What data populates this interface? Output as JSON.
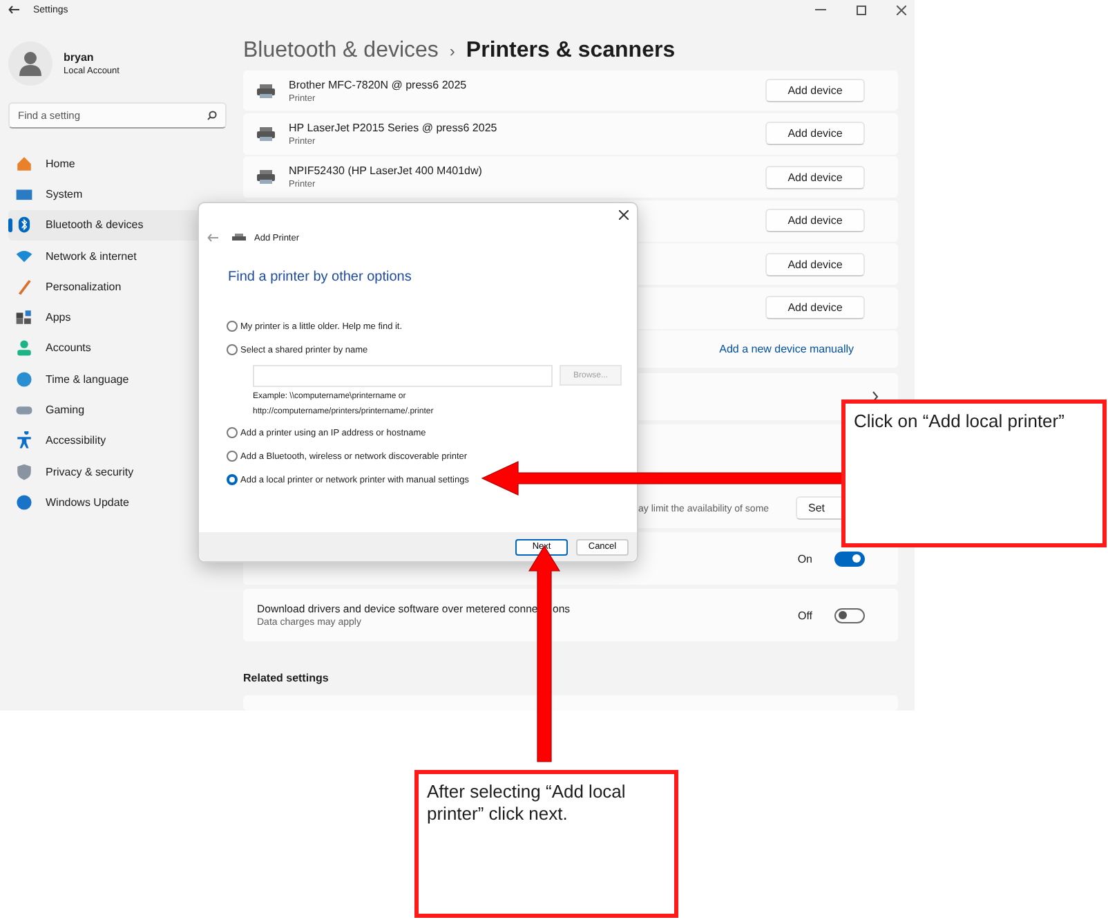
{
  "window": {
    "title": "Settings"
  },
  "account": {
    "name": "bryan",
    "type": "Local Account"
  },
  "search": {
    "placeholder": "Find a setting"
  },
  "nav": [
    {
      "label": "Home",
      "selected": false
    },
    {
      "label": "System",
      "selected": false
    },
    {
      "label": "Bluetooth & devices",
      "selected": true
    },
    {
      "label": "Network & internet",
      "selected": false
    },
    {
      "label": "Personalization",
      "selected": false
    },
    {
      "label": "Apps",
      "selected": false
    },
    {
      "label": "Accounts",
      "selected": false
    },
    {
      "label": "Time & language",
      "selected": false
    },
    {
      "label": "Gaming",
      "selected": false
    },
    {
      "label": "Accessibility",
      "selected": false
    },
    {
      "label": "Privacy & security",
      "selected": false
    },
    {
      "label": "Windows Update",
      "selected": false
    }
  ],
  "breadcrumb": {
    "parent": "Bluetooth & devices",
    "separator": "›",
    "current": "Printers & scanners"
  },
  "printers": [
    {
      "name": "Brother MFC-7820N @ press6 2025",
      "type": "Printer",
      "button": "Add device"
    },
    {
      "name": "HP LaserJet P2015 Series @ press6 2025",
      "type": "Printer",
      "button": "Add device"
    },
    {
      "name": "NPIF52430 (HP LaserJet 400 M401dw)",
      "type": "Printer",
      "button": "Add device"
    },
    {
      "button": "Add device"
    },
    {
      "button": "Add device"
    },
    {
      "button": "Add device"
    }
  ],
  "add_manually_link": "Add a new device manually",
  "settings_rows": [
    {
      "kind": "chevron"
    },
    {
      "kind": "button",
      "description": "ay limit the availability of some",
      "button": "Set"
    },
    {
      "kind": "toggle",
      "on": true,
      "state_label": "On"
    },
    {
      "kind": "toggle",
      "title": "Download drivers and device software over metered conne",
      "title_tail": "ons",
      "description": "Data charges may apply",
      "on": false,
      "state_label": "Off"
    }
  ],
  "related_settings": {
    "title": "Related settings"
  },
  "dialog": {
    "title": "Add Printer",
    "heading": "Find a printer by other options",
    "options": [
      {
        "label": "My printer is a little older. Help me find it.",
        "selected": false
      },
      {
        "label": "Select a shared printer by name",
        "selected": false,
        "browse_button": {
          "label": "Browse...",
          "disabled": true
        },
        "example_lines": [
          "Example: \\\\computername\\printername or",
          "http://computername/printers/printername/.printer"
        ]
      },
      {
        "label": "Add a printer using an IP address or hostname",
        "selected": false
      },
      {
        "label": "Add a Bluetooth, wireless or network discoverable printer",
        "selected": false
      },
      {
        "label": "Add a local printer or network printer with manual settings",
        "selected": true
      }
    ],
    "buttons": [
      {
        "label": "Next",
        "default": true
      },
      {
        "label": "Cancel",
        "default": false
      }
    ]
  },
  "callouts": [
    {
      "text": "Click on “Add local printer”"
    },
    {
      "text": "After selecting “Add local printer” click next."
    }
  ]
}
